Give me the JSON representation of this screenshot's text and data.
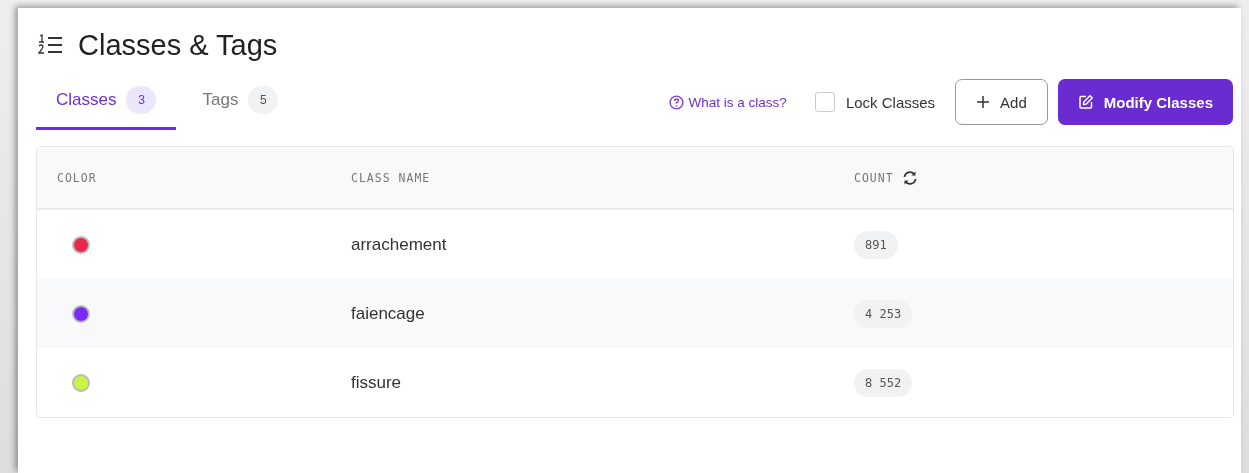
{
  "page": {
    "title": "Classes & Tags"
  },
  "tabs": [
    {
      "label": "Classes",
      "count": "3",
      "selected": true
    },
    {
      "label": "Tags",
      "count": "5",
      "selected": false
    }
  ],
  "toolbar": {
    "help_link": "What is a class?",
    "lock_checkbox": {
      "label": "Lock Classes",
      "checked": false
    },
    "add_button": "Add",
    "modify_button": "Modify Classes"
  },
  "table": {
    "columns": [
      "COLOR",
      "CLASS NAME",
      "COUNT"
    ],
    "rows": [
      {
        "color": "#e8294f",
        "name": "arrachement",
        "count": "891"
      },
      {
        "color": "#7b2bf9",
        "name": "faiencage",
        "count": "4 253"
      },
      {
        "color": "#c8f542",
        "name": "fissure",
        "count": "8 552"
      }
    ]
  }
}
